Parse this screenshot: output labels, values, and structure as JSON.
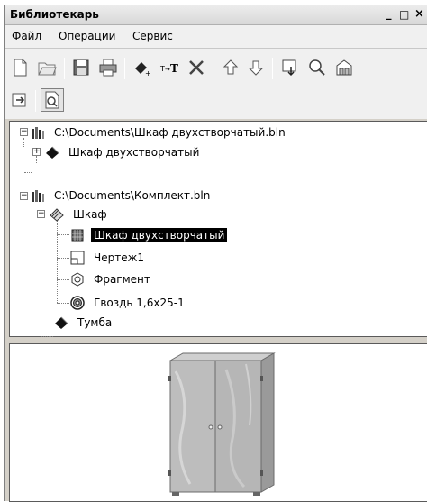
{
  "window": {
    "title": "Библиотекарь",
    "controls": [
      "_",
      "□",
      "×"
    ]
  },
  "menu": {
    "items": [
      "Файл",
      "Операции",
      "Сервис"
    ]
  },
  "toolbar": {
    "icons": [
      "new-file-icon",
      "open-folder-icon",
      "save-icon",
      "print-icon",
      "add-element-icon",
      "rename-icon",
      "delete-icon",
      "move-up-icon",
      "move-down-icon",
      "insert-to-document-icon",
      "search-icon",
      "library-icon",
      "export-icon",
      "preview-icon"
    ]
  },
  "tree": {
    "nodes": [
      {
        "label": "C:\\Documents\\Шкаф двухстворчатый.bln",
        "icon": "library-file-icon"
      },
      {
        "label": "Шкаф двухстворчатый",
        "icon": "part-icon"
      },
      {
        "label": "C:\\Documents\\Комплект.bln",
        "icon": "library-file-icon"
      },
      {
        "label": "Шкаф",
        "icon": "assembly-icon"
      },
      {
        "label": "Шкаф двухстворчатый",
        "icon": "model-3d-icon"
      },
      {
        "label": "Чертеж1",
        "icon": "drawing-icon"
      },
      {
        "label": "Фрагмент",
        "icon": "fragment-icon"
      },
      {
        "label": "Гвоздь 1,6х25-1",
        "icon": "standard-part-icon"
      },
      {
        "label": "Тумба",
        "icon": "part-icon"
      }
    ],
    "selected_index": 4
  },
  "preview": {
    "subject": "two-door wardrobe 3D model",
    "color": "#b9b9b9"
  }
}
